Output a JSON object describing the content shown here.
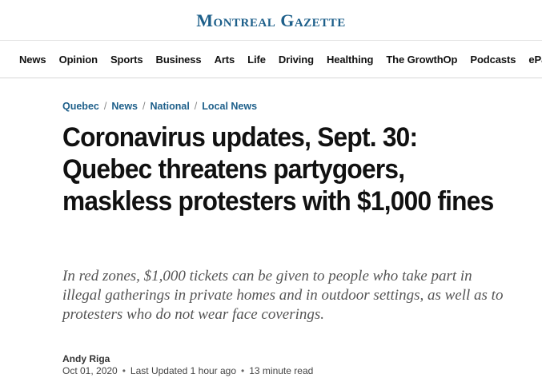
{
  "masthead": {
    "logo": "Montreal Gazette"
  },
  "nav": {
    "items": [
      "News",
      "Opinion",
      "Sports",
      "Business",
      "Arts",
      "Life",
      "Driving",
      "Healthing",
      "The GrowthOp",
      "Podcasts",
      "ePaper"
    ]
  },
  "breadcrumb": [
    "Quebec",
    "News",
    "National",
    "Local News"
  ],
  "article": {
    "headline": "Coronavirus updates, Sept. 30: Quebec threatens partygoers, maskless protesters with $1,000 fines",
    "deck": "In red zones, $1,000 tickets can be given to people who take part in illegal gatherings in private homes and in outdoor settings, as well as to protesters who do not wear face coverings.",
    "author": "Andy Riga",
    "date": "Oct 01, 2020",
    "updated": "Last Updated 1 hour ago",
    "read_time": "13 minute read"
  },
  "colors": {
    "brand": "#1d5f8a",
    "text": "#111111",
    "deck": "#555555"
  }
}
